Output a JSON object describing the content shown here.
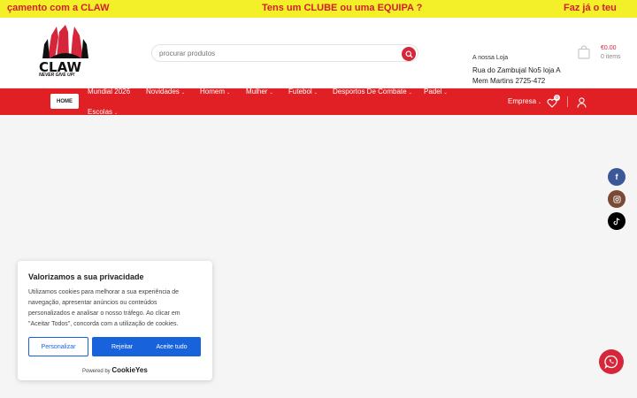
{
  "topbar": {
    "messages": [
      "çamento com a CLAW",
      "Tens um CLUBE ou uma EQUIPA ?",
      "Faz já o teu"
    ]
  },
  "header": {
    "logo_word": "CLAW",
    "logo_tagline": "NEVER GIVE UP!",
    "search": {
      "placeholder": "procurar produtos",
      "icon": "search-icon"
    },
    "store": {
      "title": "A nossa Loja",
      "address_line1": "Rua do Zambujal No5 loja A",
      "address_line2": "Mem Martins 2725-472"
    },
    "cart": {
      "amount": "€0.00",
      "items": "0 items",
      "icon": "shopping-bag-icon"
    }
  },
  "nav": {
    "home": "HOME",
    "items": [
      "Mundial 2026",
      "Novidades",
      "Homem",
      "Mulher",
      "Futebol",
      "Desportos De Combate",
      "Padel",
      "Escolas"
    ],
    "company": "Empresa",
    "wishlist_count": "0",
    "icons": [
      "heart-icon",
      "user-icon"
    ]
  },
  "social": [
    "facebook-icon",
    "instagram-icon",
    "tiktok-icon"
  ],
  "cookie": {
    "title": "Valorizamos a sua privacidade",
    "text_lines": [
      "Utilizamos cookies para melhorar a sua experiência de",
      "navegação, apresentar anúncios ou conteúdos",
      "personalizados e analisar o nosso tráfego. Ao clicar em",
      "\"Aceitar Todos\", concorda com a utilização de cookies."
    ],
    "buttons": {
      "customize": "Personalizar",
      "reject": "Rejeitar",
      "accept": "Aceite tudo"
    },
    "powered_by": "Powered by",
    "brand": "CookieYes"
  },
  "colors": {
    "accent_red": "#e02025",
    "topbar_yellow": "#f3f02a",
    "cookie_blue": "#1863dc"
  }
}
